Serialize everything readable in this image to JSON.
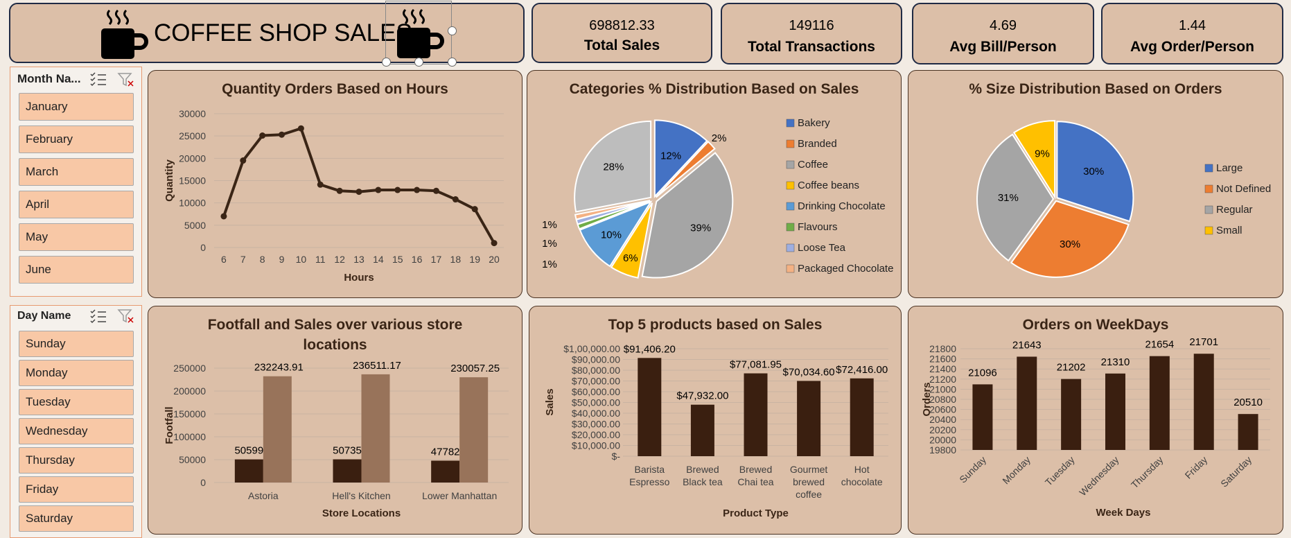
{
  "header": {
    "title": "COFFEE SHOP SALES"
  },
  "kpis": [
    {
      "value": "698812.33",
      "label": "Total Sales"
    },
    {
      "value": "149116",
      "label": "Total Transactions"
    },
    {
      "value": "4.69",
      "label": "Avg Bill/Person"
    },
    {
      "value": "1.44",
      "label": "Avg Order/Person"
    }
  ],
  "slicers": {
    "month": {
      "title": "Month Na...",
      "items": [
        "January",
        "February",
        "March",
        "April",
        "May",
        "June"
      ]
    },
    "day": {
      "title": "Day Name",
      "items": [
        "Sunday",
        "Monday",
        "Tuesday",
        "Wednesday",
        "Thursday",
        "Friday",
        "Saturday"
      ]
    }
  },
  "colors": {
    "dark_brown": "#3a1f10",
    "light_brown": "#98735a",
    "panel_bg": "#dcbfa8",
    "line": "#3a2516"
  },
  "chart_data": [
    {
      "id": "hours",
      "type": "line",
      "title": "Quantity Orders Based on Hours",
      "xlabel": "Hours",
      "ylabel": "Quantity",
      "x": [
        6,
        7,
        8,
        9,
        10,
        11,
        12,
        13,
        14,
        15,
        16,
        17,
        18,
        19,
        20
      ],
      "values": [
        7000,
        19500,
        25100,
        25300,
        26700,
        14100,
        12700,
        12500,
        12900,
        12900,
        12900,
        12700,
        10800,
        8600,
        1000
      ],
      "ylim": [
        0,
        30000
      ],
      "yticks": [
        0,
        5000,
        10000,
        15000,
        20000,
        25000,
        30000
      ],
      "grid": true
    },
    {
      "id": "categories",
      "type": "pie",
      "title": "Categories % Distribution Based on Sales",
      "categories": [
        "Bakery",
        "Branded",
        "Coffee",
        "Coffee beans",
        "Drinking Chocolate",
        "Flavours",
        "Loose Tea",
        "Packaged Chocolate"
      ],
      "values": [
        12,
        2,
        39,
        6,
        10,
        1,
        1,
        1
      ],
      "labels": [
        "12%",
        "2%",
        "39%",
        "6%",
        "10%",
        "1%",
        "1%",
        "1%"
      ],
      "extra_slice": {
        "label": "28%",
        "value": 28
      },
      "colors": [
        "#4472c4",
        "#ed7d31",
        "#a5a5a5",
        "#ffc000",
        "#5b9bd5",
        "#70ad47",
        "#9eaee0",
        "#f4b183"
      ],
      "legend": "right"
    },
    {
      "id": "sizes",
      "type": "pie",
      "title": "% Size Distribution Based on Orders",
      "categories": [
        "Large",
        "Not Defined",
        "Regular",
        "Small"
      ],
      "values": [
        30,
        30,
        31,
        9
      ],
      "labels": [
        "30%",
        "30%",
        "31%",
        "9%"
      ],
      "colors": [
        "#4472c4",
        "#ed7d31",
        "#a5a5a5",
        "#ffc000"
      ],
      "legend": "right"
    },
    {
      "id": "stores",
      "type": "bar",
      "title": "Footfall and Sales over various store locations",
      "xlabel": "Store Locations",
      "ylabel": "Footfall",
      "categories": [
        "Astoria",
        "Hell's Kitchen",
        "Lower Manhattan"
      ],
      "series": [
        {
          "values": [
            50599,
            50735,
            47782
          ],
          "labels": [
            "50599",
            "50735",
            "47782"
          ]
        },
        {
          "values": [
            232243.91,
            236511.17,
            230057.25
          ],
          "labels": [
            "232243.91",
            "236511.17",
            "230057.25"
          ]
        }
      ],
      "ylim": [
        0,
        250000
      ],
      "yticks": [
        0,
        50000,
        100000,
        150000,
        200000,
        250000
      ]
    },
    {
      "id": "products",
      "type": "bar",
      "title": "Top 5 products based on Sales",
      "xlabel": "Product Type",
      "ylabel": "Sales",
      "categories": [
        [
          "Barista",
          "Espresso"
        ],
        [
          "Brewed",
          "Black tea"
        ],
        [
          "Brewed",
          "Chai tea"
        ],
        [
          "Gourmet",
          "brewed",
          "coffee"
        ],
        [
          "Hot",
          "chocolate"
        ]
      ],
      "values": [
        91406.2,
        47932.0,
        77081.95,
        70034.6,
        72416.0
      ],
      "labels": [
        "$91,406.20",
        "$47,932.00",
        "$77,081.95",
        "$70,034.60",
        "$72,416.00"
      ],
      "ylim": [
        0,
        100000
      ],
      "yticks": [
        "$-",
        "$10,000.00",
        "$20,000.00",
        "$30,000.00",
        "$40,000.00",
        "$50,000.00",
        "$60,000.00",
        "$70,000.00",
        "$80,000.00",
        "$90,000.00",
        "$1,00,000.00"
      ]
    },
    {
      "id": "weekdays",
      "type": "bar",
      "title": "Orders on WeekDays",
      "xlabel": "Week Days",
      "ylabel": "Orders",
      "categories": [
        "Sunday",
        "Monday",
        "Tuesday",
        "Wednesday",
        "Thursday",
        "Friday",
        "Saturday"
      ],
      "values": [
        21096,
        21643,
        21202,
        21310,
        21654,
        21701,
        20510
      ],
      "labels": [
        "21096",
        "21643",
        "21202",
        "21310",
        "21654",
        "21701",
        "20510"
      ],
      "ylim": [
        19800,
        21800
      ],
      "yticks": [
        19800,
        20000,
        20200,
        20400,
        20600,
        20800,
        21000,
        21200,
        21400,
        21600,
        21800
      ]
    }
  ]
}
